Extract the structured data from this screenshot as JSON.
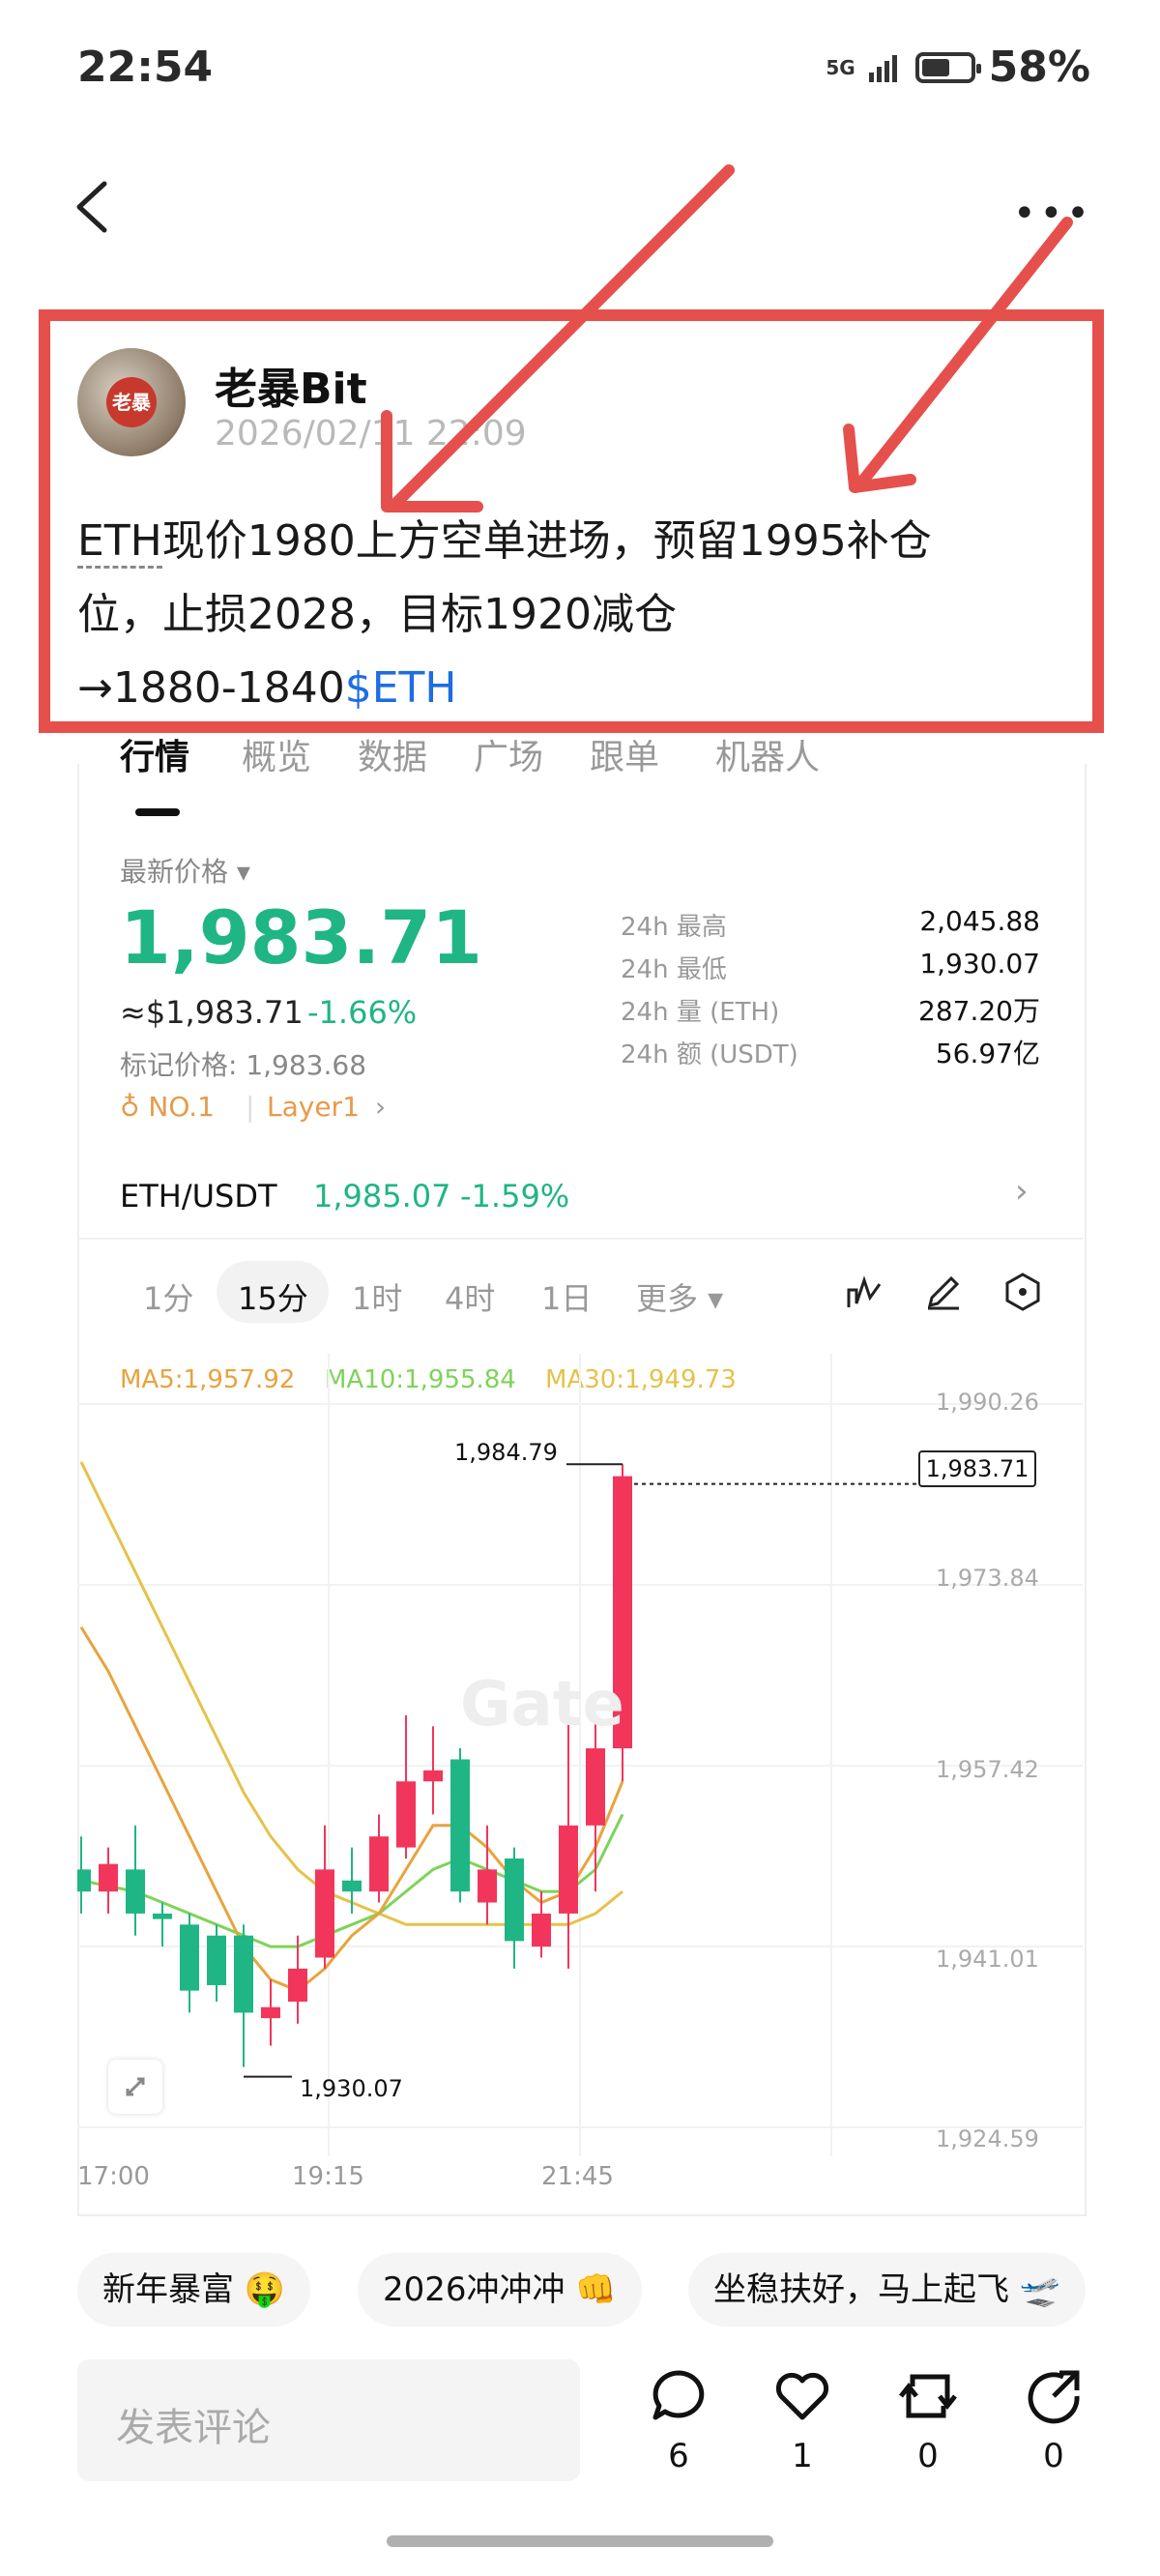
{
  "status_bar": {
    "time": "22:54",
    "network": "5G",
    "battery": "58%"
  },
  "post": {
    "author": "老暴Bit",
    "avatar_text": "老暴",
    "date": "2026/02/11 22:09",
    "text_ticker": "ETH",
    "text_line1": "现价1980上方空单进场，预留1995补仓",
    "text_line2": "位，止损2028，目标1920减仓",
    "text_line3": "→1880-1840",
    "tag": "$ETH"
  },
  "market": {
    "tabs": [
      "行情",
      "概览",
      "数据",
      "广场",
      "跟单",
      "机器人"
    ],
    "latest_label": "最新价格 ▾",
    "price": "1,983.71",
    "usd_price": "≈$1,983.71",
    "change": "-1.66%",
    "mark_price": "标记价格: 1,983.68",
    "badge_rank": "♁ NO.1",
    "badge_category": "Layer1",
    "stats": [
      {
        "label": "24h  最高",
        "value": "2,045.88"
      },
      {
        "label": "24h  最低",
        "value": "1,930.07"
      },
      {
        "label": "24h  量 (ETH)",
        "value": "287.20万"
      },
      {
        "label": "24h  额 (USDT)",
        "value": "56.97亿"
      }
    ],
    "pair": {
      "name": "ETH/USDT",
      "price": "1,985.07",
      "change": "-1.59%"
    },
    "intervals": [
      "1分",
      "15分",
      "1时",
      "4时",
      "1日",
      "更多 ▾"
    ],
    "active_interval": "15分"
  },
  "chart_data": {
    "type": "candlestick",
    "ma": [
      {
        "name": "MA5",
        "label": "MA5:1,957.92",
        "color": "#e8a33d"
      },
      {
        "name": "MA10",
        "label": "MA10:1,955.84",
        "color": "#7ed35a"
      },
      {
        "name": "MA30",
        "label": "MA30:1,949.73",
        "color": "#e5c24a"
      }
    ],
    "y_ticks": [
      "1,990.26",
      "1,973.84",
      "1,957.42",
      "1,941.01",
      "1,924.59"
    ],
    "ylim": [
      1924.59,
      1990.26
    ],
    "x_ticks": [
      "17:00",
      "19:15",
      "21:45"
    ],
    "high_label": "1,984.79",
    "low_label": "1,930.07",
    "last_price_label": "1,983.71",
    "watermark": "Gate",
    "candles": [
      {
        "o": 1948.0,
        "c": 1946.0,
        "h": 1951.0,
        "l": 1944.0
      },
      {
        "o": 1946.0,
        "c": 1948.5,
        "h": 1950.0,
        "l": 1944.0
      },
      {
        "o": 1948.0,
        "c": 1944.0,
        "h": 1952.0,
        "l": 1942.0
      },
      {
        "o": 1944.0,
        "c": 1943.5,
        "h": 1945.0,
        "l": 1941.0
      },
      {
        "o": 1943.0,
        "c": 1937.0,
        "h": 1944.0,
        "l": 1935.0
      },
      {
        "o": 1942.0,
        "c": 1937.5,
        "h": 1943.0,
        "l": 1936.0
      },
      {
        "o": 1942.0,
        "c": 1935.0,
        "h": 1943.0,
        "l": 1930.07
      },
      {
        "o": 1934.5,
        "c": 1935.5,
        "h": 1938.0,
        "l": 1932.0
      },
      {
        "o": 1936.0,
        "c": 1939.0,
        "h": 1942.0,
        "l": 1934.0
      },
      {
        "o": 1940.0,
        "c": 1948.0,
        "h": 1952.0,
        "l": 1939.0
      },
      {
        "o": 1947.0,
        "c": 1946.0,
        "h": 1950.0,
        "l": 1944.0
      },
      {
        "o": 1946.0,
        "c": 1951.0,
        "h": 1953.0,
        "l": 1945.0
      },
      {
        "o": 1950.0,
        "c": 1956.0,
        "h": 1962.0,
        "l": 1949.0
      },
      {
        "o": 1956.0,
        "c": 1957.0,
        "h": 1961.0,
        "l": 1953.0
      },
      {
        "o": 1958.0,
        "c": 1946.0,
        "h": 1959.0,
        "l": 1945.0
      },
      {
        "o": 1945.0,
        "c": 1948.0,
        "h": 1952.0,
        "l": 1943.0
      },
      {
        "o": 1949.0,
        "c": 1941.5,
        "h": 1950.0,
        "l": 1939.0
      },
      {
        "o": 1941.0,
        "c": 1944.0,
        "h": 1946.0,
        "l": 1940.0
      },
      {
        "o": 1944.0,
        "c": 1952.0,
        "h": 1965.0,
        "l": 1939.0
      },
      {
        "o": 1952.0,
        "c": 1959.0,
        "h": 1962.0,
        "l": 1946.0
      },
      {
        "o": 1959.0,
        "c": 1983.71,
        "h": 1984.79,
        "l": 1956.0
      }
    ],
    "ma5": [
      1970,
      1966,
      1961,
      1956,
      1951,
      1946,
      1941,
      1938,
      1937,
      1939,
      1942,
      1944,
      1948,
      1952,
      1952,
      1950,
      1947,
      1945,
      1946,
      1950,
      1956
    ],
    "ma10": [
      1947,
      1946.5,
      1946,
      1945,
      1944,
      1943,
      1942,
      1941,
      1941,
      1942,
      1943,
      1944,
      1946,
      1948,
      1949,
      1948,
      1947,
      1946,
      1946,
      1948,
      1953
    ],
    "ma30": [
      1985,
      1980,
      1975,
      1970,
      1965,
      1960,
      1955,
      1951,
      1948,
      1946,
      1945,
      1944,
      1943,
      1943,
      1943,
      1943,
      1943,
      1943,
      1943,
      1944,
      1946
    ]
  },
  "reactions": [
    "新年暴富 🤑",
    "2026冲冲冲 👊",
    "坐稳扶好，马上起飞 🛫"
  ],
  "comment_placeholder": "发表评论",
  "actions": [
    {
      "icon": "comment-icon",
      "count": "6"
    },
    {
      "icon": "heart-icon",
      "count": "1"
    },
    {
      "icon": "repost-icon",
      "count": "0"
    },
    {
      "icon": "share-icon",
      "count": "0"
    }
  ],
  "colors": {
    "up": "#1fb584",
    "down": "#f2365b",
    "highlight": "#e5504d",
    "link": "#1f6de0"
  }
}
